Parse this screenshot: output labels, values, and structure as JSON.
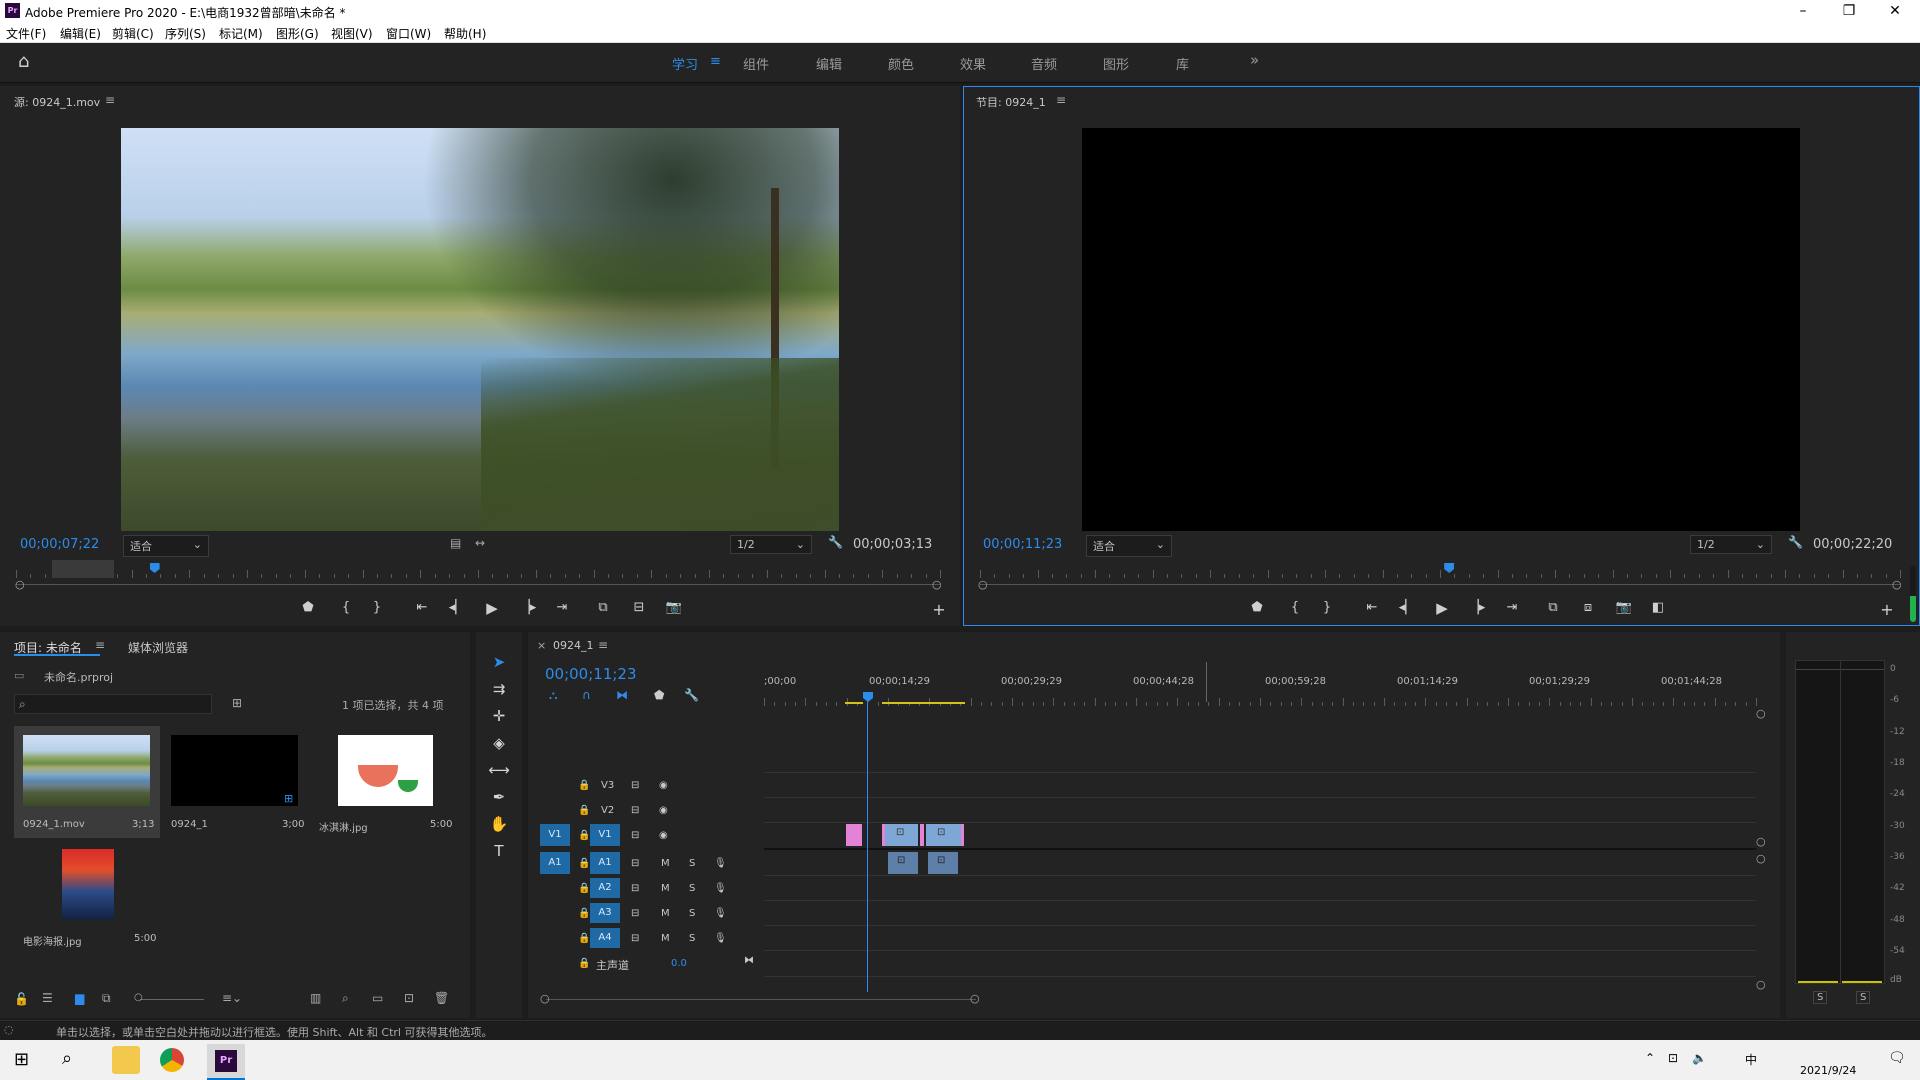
{
  "window": {
    "title": "Adobe Premiere Pro 2020 - E:\\电商1932曾部暗\\未命名 *",
    "app_icon": "Pr",
    "minimize": "–",
    "maximize": "❐",
    "close": "✕"
  },
  "menu": [
    "文件(F)",
    "编辑(E)",
    "剪辑(C)",
    "序列(S)",
    "标记(M)",
    "图形(G)",
    "视图(V)",
    "窗口(W)",
    "帮助(H)"
  ],
  "workspaces": {
    "items": [
      "学习",
      "组件",
      "编辑",
      "颜色",
      "效果",
      "音频",
      "图形",
      "库"
    ],
    "active": "学习",
    "more": "»"
  },
  "source_monitor": {
    "title": "源: 0924_1.mov",
    "timecode_left": "00;00;07;22",
    "fit": "适合",
    "quality": "1/2",
    "timecode_right": "00;00;03;13",
    "playhead_fraction": 0.15
  },
  "program_monitor": {
    "title": "节目: 0924_1",
    "timecode_left": "00;00;11;23",
    "fit": "适合",
    "quality": "1/2",
    "timecode_right": "00;00;22;20",
    "playhead_fraction": 0.51
  },
  "project": {
    "tab_active": "项目: 未命名",
    "tab_other": "媒体浏览器",
    "file": "未命名.prproj",
    "search_placeholder": "",
    "selection": "1 项已选择，共 4 项",
    "items": [
      {
        "name": "0924_1.mov",
        "duration": "3;13"
      },
      {
        "name": "0924_1",
        "duration": "3;00"
      },
      {
        "name": "冰淇淋.jpg",
        "duration": "5:00"
      },
      {
        "name": "电影海报.jpg",
        "duration": "5:00"
      }
    ]
  },
  "timeline": {
    "tab": "0924_1",
    "timecode": "00;00;11;23",
    "ruler": [
      ";00;00",
      "00;00;14;29",
      "00;00;29;29",
      "00;00;44;28",
      "00;00;59;28",
      "00;01;14;29",
      "00;01;29;29",
      "00;01;44;28"
    ],
    "tracks": {
      "v3": "V3",
      "v2": "V2",
      "v1": "V1",
      "a1": "A1",
      "a2": "A2",
      "a3": "A3",
      "a4": "A4"
    },
    "source_v": "V1",
    "source_a": "A1",
    "mute": "M",
    "solo": "S",
    "master": "主声道",
    "master_val": "0.0"
  },
  "meter": {
    "labels": [
      "0",
      "-6",
      "-12",
      "-18",
      "-24",
      "-30",
      "-36",
      "-42",
      "-48",
      "-54",
      "dB"
    ],
    "solo_l": "S",
    "solo_r": "S"
  },
  "status": {
    "text": "单击以选择，或单击空白处并拖动以进行框选。使用 Shift、Alt 和 Ctrl 可获得其他选项。"
  },
  "taskbar": {
    "date": "2021/9/24",
    "ime": "中"
  }
}
